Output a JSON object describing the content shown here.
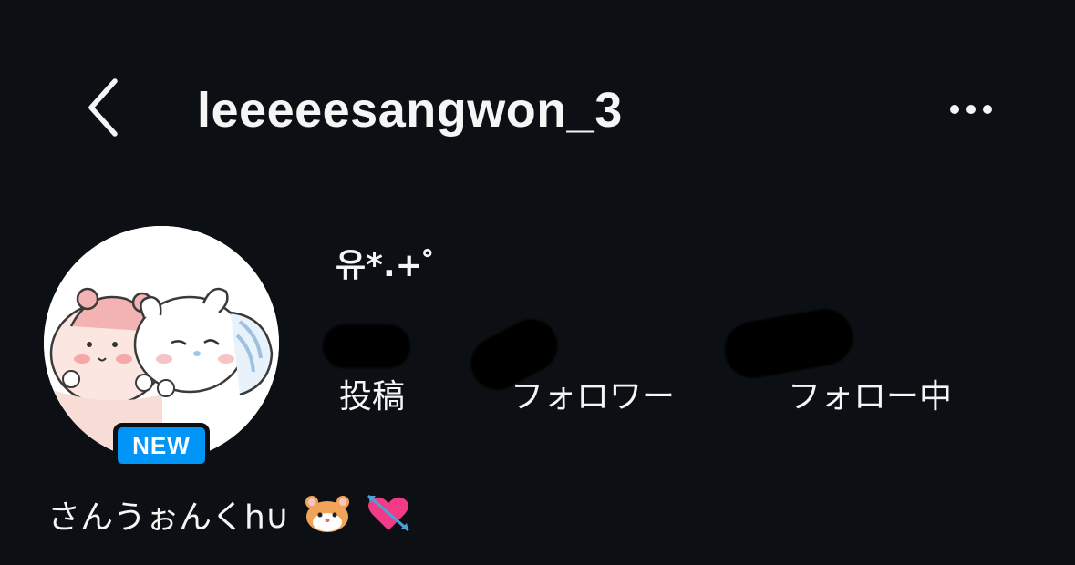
{
  "header": {
    "username": "leeeeesangwon_3",
    "back_icon": "chevron-left-icon",
    "more_icon": "more-horizontal-icon"
  },
  "profile": {
    "display_name": "유*.+゜",
    "avatar_badge": "NEW",
    "bio_name": "さんうぉんく",
    "bio_name_suffix": "h∪",
    "bio_emojis": [
      "hamster-face-emoji",
      "heart-with-arrow-emoji"
    ]
  },
  "stats": {
    "posts_label": "投稿",
    "followers_label": "フォロワー",
    "following_label": "フォロー中"
  },
  "colors": {
    "background": "#0c1014",
    "text": "#f5f5f5",
    "badge": "#0095f6"
  }
}
